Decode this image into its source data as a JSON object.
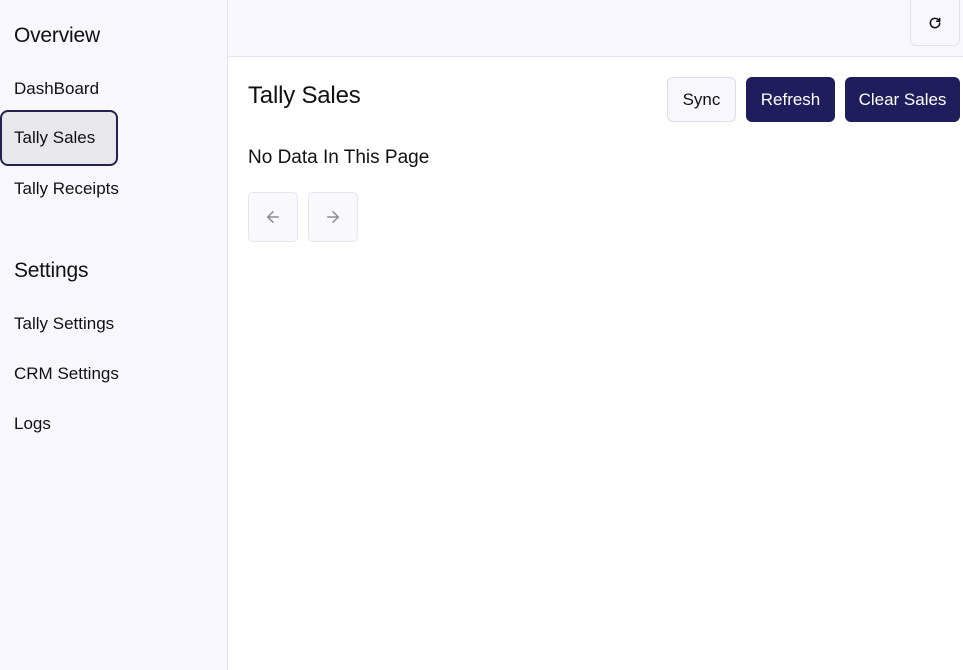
{
  "sidebar": {
    "sections": [
      {
        "title": "Overview",
        "items": [
          {
            "label": "DashBoard",
            "active": false
          },
          {
            "label": "Tally Sales",
            "active": true
          },
          {
            "label": "Tally Receipts",
            "active": false
          }
        ]
      },
      {
        "title": "Settings",
        "items": [
          {
            "label": "Tally Settings",
            "active": false
          },
          {
            "label": "CRM Settings",
            "active": false
          },
          {
            "label": "Logs",
            "active": false
          }
        ]
      }
    ]
  },
  "topbar": {
    "reload_icon": "refresh-cw-icon"
  },
  "main": {
    "title": "Tally Sales",
    "buttons": {
      "sync": "Sync",
      "refresh": "Refresh",
      "clear": "Clear Sales"
    },
    "empty_message": "No Data In This Page",
    "pagination": {
      "prev_icon": "arrow-left-icon",
      "next_icon": "arrow-right-icon"
    }
  },
  "colors": {
    "sidebar_bg": "#f8f7fe",
    "accent": "#1f1d5c",
    "active_item_bg": "#e8e8ec",
    "active_item_border": "#23214f"
  }
}
